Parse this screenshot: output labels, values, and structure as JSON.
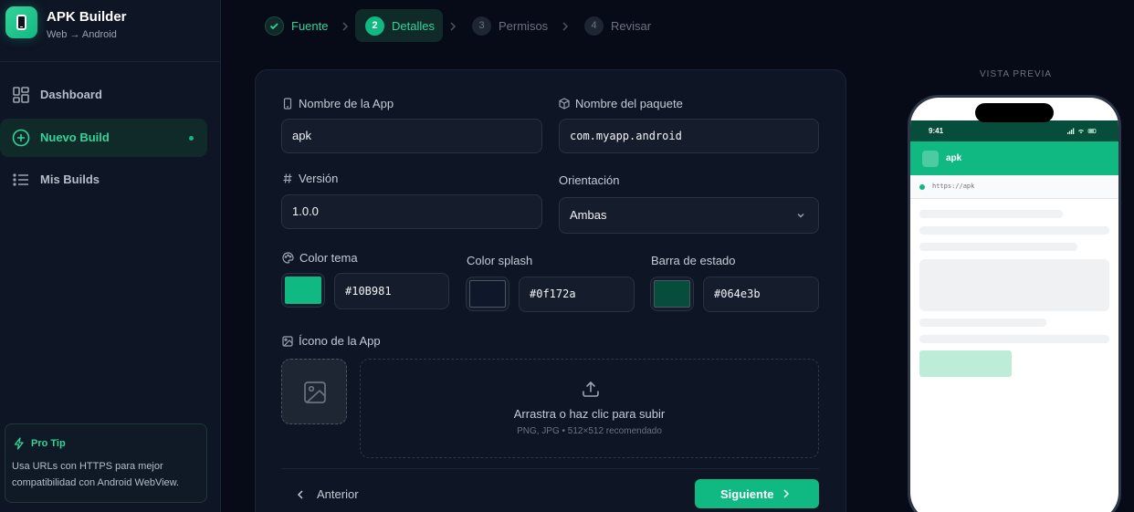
{
  "brand": {
    "title": "APK Builder",
    "subtitle": "Web → Android"
  },
  "sidebar": {
    "items": [
      {
        "label": "Dashboard",
        "icon": "dashboard-grid-icon",
        "active": false
      },
      {
        "label": "Nuevo Build",
        "icon": "plus-circle-icon",
        "active": true
      },
      {
        "label": "Mis Builds",
        "icon": "list-icon",
        "active": false
      }
    ],
    "tip": {
      "title": "Pro Tip",
      "text": "Usa URLs con HTTPS para mejor compatibilidad con Android WebView.",
      "icon": "lightning-icon"
    }
  },
  "stepper": [
    {
      "num": "",
      "label": "Fuente",
      "state": "done"
    },
    {
      "num": "2",
      "label": "Detalles",
      "state": "current"
    },
    {
      "num": "3",
      "label": "Permisos",
      "state": "todo"
    },
    {
      "num": "4",
      "label": "Revisar",
      "state": "todo"
    }
  ],
  "form": {
    "app_name": {
      "label": "Nombre de la App",
      "value": "apk"
    },
    "package": {
      "label": "Nombre del paquete",
      "value": "com.myapp.android"
    },
    "version": {
      "label": "Versión",
      "value": "1.0.0"
    },
    "orientation": {
      "label": "Orientación",
      "value": "Ambas"
    },
    "theme_color": {
      "label": "Color tema",
      "value": "#10B981",
      "color": "#10b981"
    },
    "splash_color": {
      "label": "Color splash",
      "value": "#0f172a",
      "color": "#0f172a"
    },
    "status_color": {
      "label": "Barra de estado",
      "value": "#064e3b",
      "color": "#064e3b"
    },
    "app_icon": {
      "label": "Ícono de la App",
      "drop_text": "Arrastra o haz clic para subir",
      "drop_hint": "PNG, JPG • 512×512 recomendado"
    }
  },
  "actions": {
    "prev": "Anterior",
    "next": "Siguiente"
  },
  "preview": {
    "label": "VISTA PREVIA",
    "time": "9:41",
    "app_name": "apk",
    "url": "https://apk"
  },
  "colors": {
    "accent": "#10b981",
    "accent_light": "#34d399",
    "bg": "#070b18",
    "panel": "#0e1525"
  }
}
